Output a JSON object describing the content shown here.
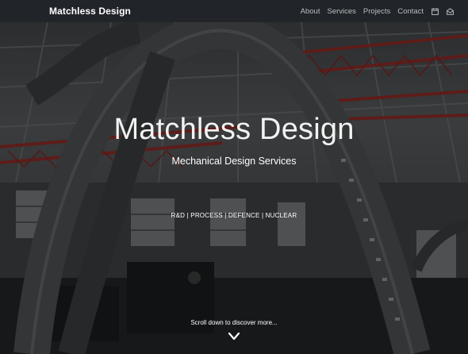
{
  "navbar": {
    "brand": "Matchless Design",
    "links": [
      {
        "label": "About"
      },
      {
        "label": "Services"
      },
      {
        "label": "Projects"
      },
      {
        "label": "Contact"
      }
    ],
    "icons": [
      "calendar-icon",
      "mail-icon"
    ],
    "background": "#212529"
  },
  "hero": {
    "title": "Matchless Design",
    "subtitle": "Mechanical Design Services",
    "tags": "R&D | PROCESS | DEFENCE | NUCLEAR",
    "scroll_hint": "Scroll down to discover more...",
    "scroll_icon": "chevron-down-icon",
    "accent_red": "#8a2a26"
  }
}
